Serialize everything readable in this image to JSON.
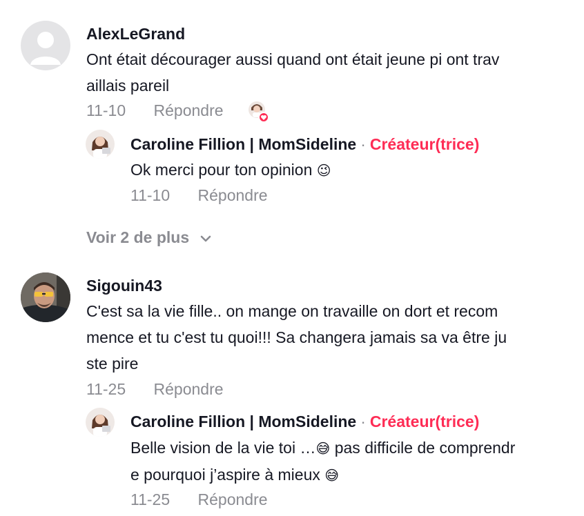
{
  "comments": [
    {
      "username": "AlexLeGrand",
      "line1": "Ont était décourager aussi quand ont était jeune pi ont trav",
      "line2": "aillais pareil",
      "date": "11-10",
      "reply_label": "Répondre"
    },
    {
      "username": "Sigouin43",
      "line1": "C'est sa la vie fille.. on mange on travaille on dort et recom",
      "line2": "mence et tu c'est tu quoi!!! Sa changera jamais sa va être ju",
      "line3": "ste pire",
      "date": "11-25",
      "reply_label": "Répondre"
    }
  ],
  "replies": [
    {
      "username": "Caroline Fillion | MomSideline",
      "separator": "·",
      "creator_label": "Créateur(trice)",
      "text": "Ok merci pour ton opinion",
      "emoji": "😉",
      "date": "11-10",
      "reply_label": "Répondre"
    },
    {
      "username": "Caroline Fillion | MomSideline",
      "separator": "·",
      "creator_label": "Créateur(trice)",
      "line1_text": "Belle vision de la vie toi …",
      "line1_emoji": "😅",
      "line1_rest": " pas difficile de comprendr",
      "line2_text": "e pourquoi j’aspire à mieux ",
      "line2_emoji": "😅",
      "date": "11-25",
      "reply_label": "Répondre"
    }
  ],
  "view_more": {
    "label": "Voir 2 de plus",
    "icon": "chevron-down-icon"
  },
  "icons": {
    "liked_by_creator": "heart-badge-icon"
  },
  "colors": {
    "creator": "#fe2c55",
    "muted": "#8a8b91",
    "text": "#161823"
  }
}
